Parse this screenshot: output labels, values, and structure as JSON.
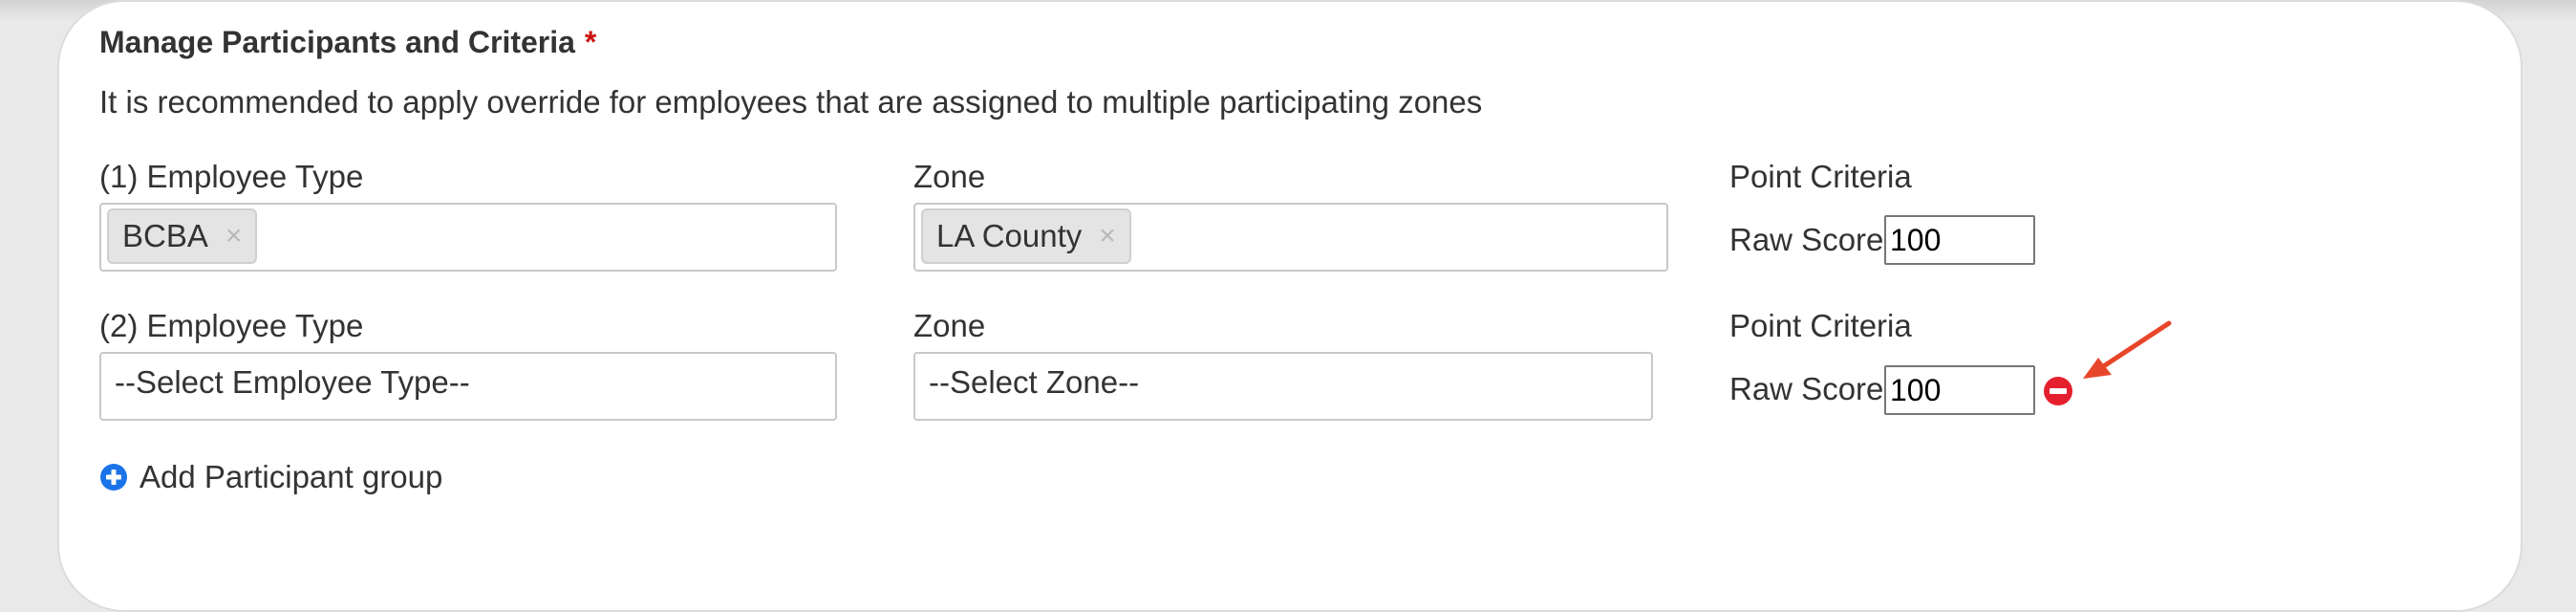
{
  "section": {
    "title": "Manage Participants and Criteria",
    "required_marker": "*",
    "hint": "It is recommended to apply override for employees that are assigned to multiple participating zones"
  },
  "groups": [
    {
      "employee_type_label": "(1) Employee Type",
      "employee_type_tags": [
        "BCBA"
      ],
      "zone_label": "Zone",
      "zone_tags": [
        "LA County"
      ],
      "criteria_label": "Point Criteria",
      "raw_score_label": "Raw Score",
      "raw_score_value": "100"
    },
    {
      "employee_type_label": "(2) Employee Type",
      "employee_type_placeholder": "--Select Employee Type--",
      "zone_label": "Zone",
      "zone_placeholder": "--Select Zone--",
      "criteria_label": "Point Criteria",
      "raw_score_label": "Raw Score",
      "raw_score_value": "100"
    }
  ],
  "tag_remove_glyph": "×",
  "add_group": {
    "label": "Add Participant group",
    "icon": "plus-circle-icon"
  },
  "icons": {
    "remove_group": "minus-circle-icon",
    "annotation": "arrow-icon"
  },
  "colors": {
    "accent_blue": "#1a73e8",
    "remove_red": "#e5202e",
    "annotation_arrow": "#e8462a",
    "required_star": "#cc1111"
  }
}
